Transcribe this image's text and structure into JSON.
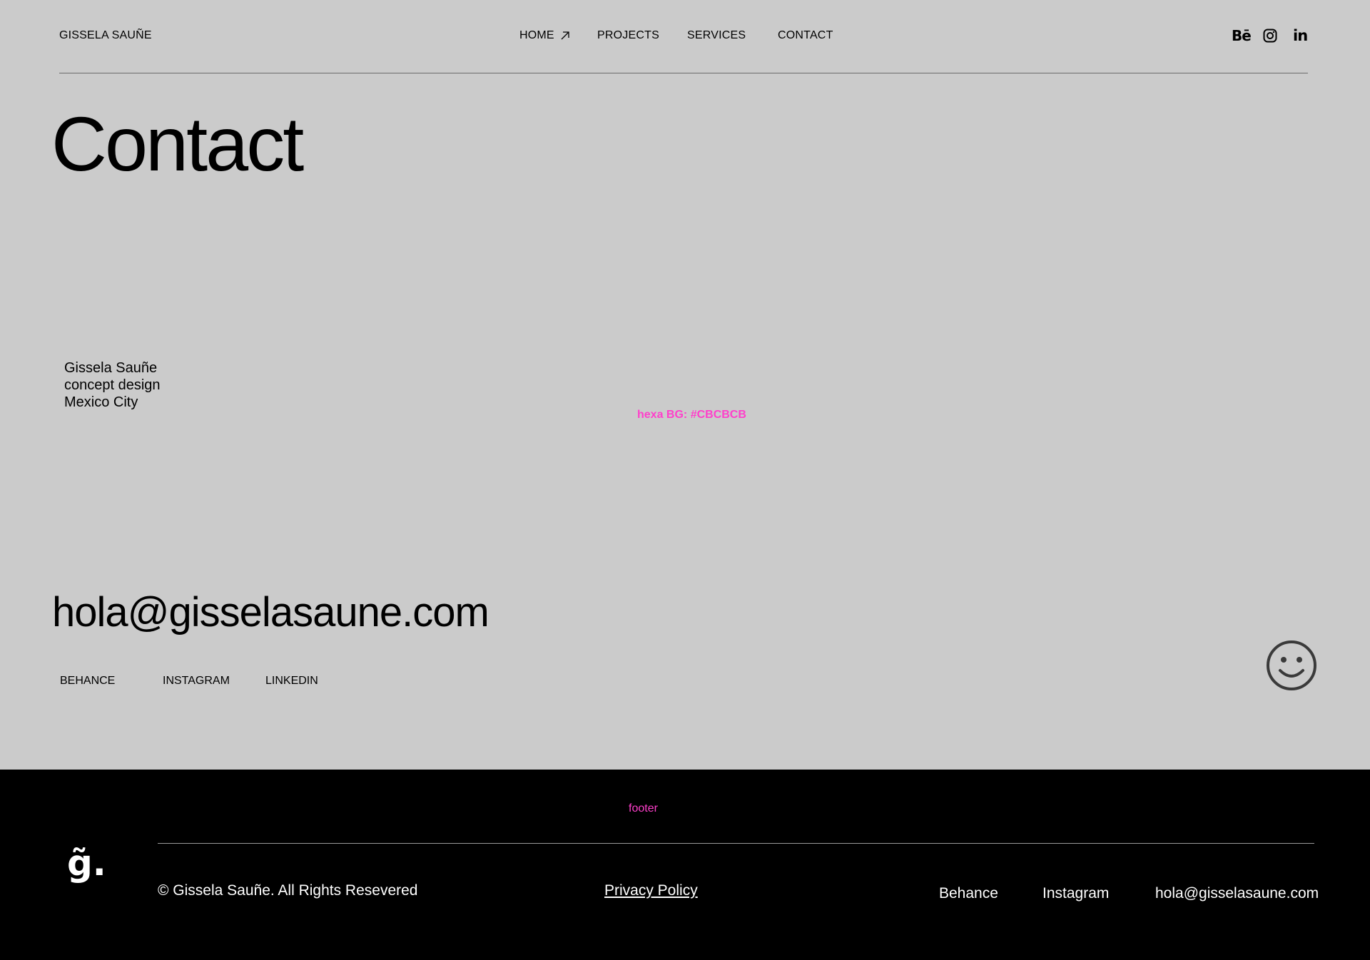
{
  "header": {
    "brand": "GISSELA SAUÑE",
    "nav": {
      "home": "HOME",
      "projects": "PROJECTS",
      "services": "SERVICES",
      "contact": "CONTACT"
    },
    "social_icons": [
      "behance-icon",
      "instagram-icon",
      "linkedin-icon"
    ],
    "behance_glyph": "Bē",
    "linkedin_glyph": "in"
  },
  "main": {
    "title": "Contact",
    "info": {
      "name": "Gissela Sauñe",
      "role": "concept design",
      "city": "Mexico City"
    },
    "bg_note": "hexa BG: #CBCBCB",
    "email": "hola@gisselasaune.com",
    "social_links": {
      "behance": "BEHANCE",
      "instagram": "INSTAGRAM",
      "linkedin": "LINKEDIN"
    }
  },
  "footer": {
    "note": "footer",
    "logo": "g̃.",
    "copyright": "© Gissela Sauñe. All Rights Resevered",
    "privacy": "Privacy Policy",
    "links": {
      "behance": "Behance",
      "instagram": "Instagram",
      "email": "hola@gisselasaune.com"
    }
  },
  "colors": {
    "background": "#CBCBCB",
    "footer_background": "#000000",
    "annotation": "#FF3FCB"
  }
}
